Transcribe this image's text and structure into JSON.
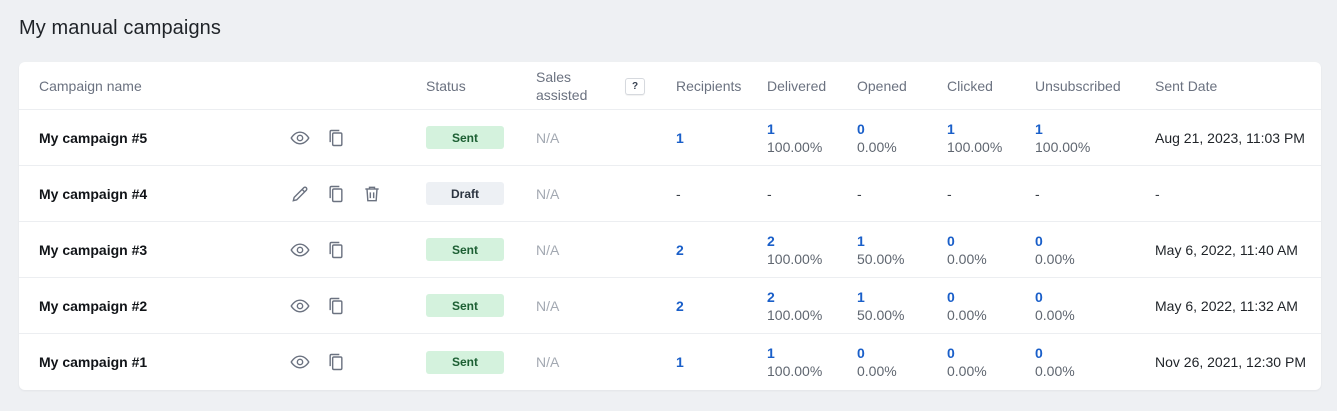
{
  "page": {
    "title": "My manual campaigns"
  },
  "colors": {
    "link": "#1a5fc9",
    "sent_bg": "#d4f2dd",
    "draft_bg": "#edf0f4"
  },
  "table": {
    "headers": {
      "name": "Campaign name",
      "status": "Status",
      "sales": "Sales assisted",
      "sales_help": "?",
      "recipients": "Recipients",
      "delivered": "Delivered",
      "opened": "Opened",
      "clicked": "Clicked",
      "unsubscribed": "Unsubscribed",
      "sent_date": "Sent Date"
    },
    "rows": [
      {
        "name": "My campaign #5",
        "actions": [
          "eye-icon",
          "copy-icon"
        ],
        "status": "Sent",
        "sales": "N/A",
        "recipients": "1",
        "delivered": "1",
        "delivered_pct": "100.00%",
        "opened": "0",
        "opened_pct": "0.00%",
        "clicked": "1",
        "clicked_pct": "100.00%",
        "unsubscribed": "1",
        "unsubscribed_pct": "100.00%",
        "sent_date": "Aug 21, 2023, 11:03 PM"
      },
      {
        "name": "My campaign #4",
        "actions": [
          "pencil-icon",
          "copy-icon",
          "trash-icon"
        ],
        "status": "Draft",
        "sales": "N/A",
        "recipients": "-",
        "delivered": "-",
        "opened": "-",
        "clicked": "-",
        "unsubscribed": "-",
        "sent_date": "-"
      },
      {
        "name": "My campaign #3",
        "actions": [
          "eye-icon",
          "copy-icon"
        ],
        "status": "Sent",
        "sales": "N/A",
        "recipients": "2",
        "delivered": "2",
        "delivered_pct": "100.00%",
        "opened": "1",
        "opened_pct": "50.00%",
        "clicked": "0",
        "clicked_pct": "0.00%",
        "unsubscribed": "0",
        "unsubscribed_pct": "0.00%",
        "sent_date": "May 6, 2022, 11:40 AM"
      },
      {
        "name": "My campaign #2",
        "actions": [
          "eye-icon",
          "copy-icon"
        ],
        "status": "Sent",
        "sales": "N/A",
        "recipients": "2",
        "delivered": "2",
        "delivered_pct": "100.00%",
        "opened": "1",
        "opened_pct": "50.00%",
        "clicked": "0",
        "clicked_pct": "0.00%",
        "unsubscribed": "0",
        "unsubscribed_pct": "0.00%",
        "sent_date": "May 6, 2022, 11:32 AM"
      },
      {
        "name": "My campaign #1",
        "actions": [
          "eye-icon",
          "copy-icon"
        ],
        "status": "Sent",
        "sales": "N/A",
        "recipients": "1",
        "delivered": "1",
        "delivered_pct": "100.00%",
        "opened": "0",
        "opened_pct": "0.00%",
        "clicked": "0",
        "clicked_pct": "0.00%",
        "unsubscribed": "0",
        "unsubscribed_pct": "0.00%",
        "sent_date": "Nov 26, 2021, 12:30 PM"
      }
    ]
  }
}
